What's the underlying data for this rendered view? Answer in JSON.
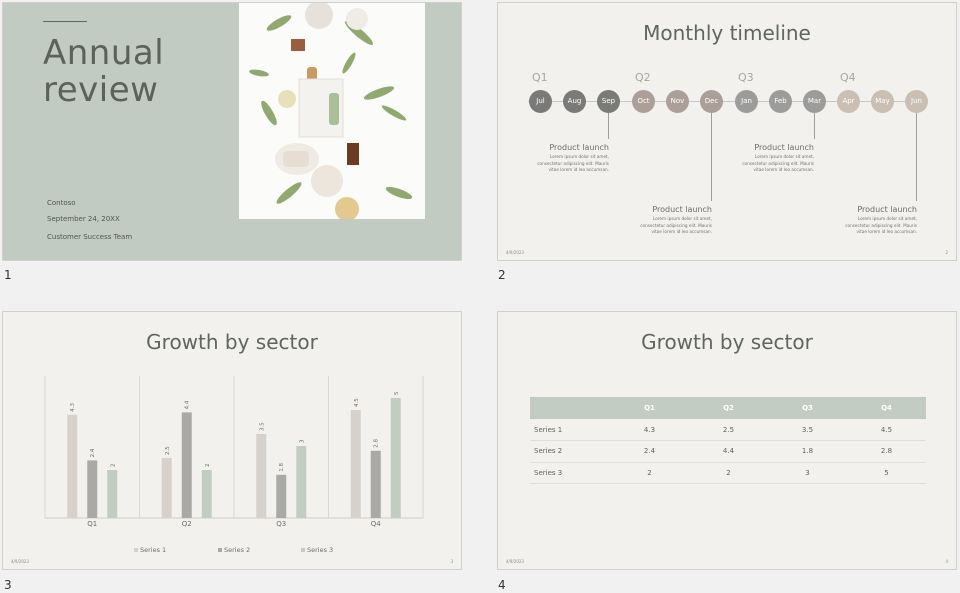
{
  "slides": [
    {
      "number": "1",
      "title_line1": "Annual",
      "title_line2": "review",
      "company": "Contoso",
      "date": "September 24, 20XX",
      "team": "Customer Success Team"
    },
    {
      "number": "2",
      "title": "Monthly timeline",
      "quarters": [
        "Q1",
        "Q2",
        "Q3",
        "Q4"
      ],
      "months": [
        "Jul",
        "Aug",
        "Sep",
        "Oct",
        "Nov",
        "Dec",
        "Jan",
        "Feb",
        "Mar",
        "Apr",
        "May",
        "Jun"
      ],
      "events": [
        {
          "heading": "Product launch",
          "body_line1": "Lorem ipsum dolor sit amet,",
          "body_line2": "consectetur adipiscing elit. Mauris",
          "body_line3": "vitae lorem id leo accumsan."
        },
        {
          "heading": "Product launch",
          "body_line1": "Lorem ipsum dolor sit amet,",
          "body_line2": "consectetur adipiscing elit. Mauris",
          "body_line3": "vitae lorem id leo accumsan."
        },
        {
          "heading": "Product launch",
          "body_line1": "Lorem ipsum dolor sit amet,",
          "body_line2": "consectetur adipiscing elit. Mauris",
          "body_line3": "vitae lorem id leo accumsan."
        },
        {
          "heading": "Product launch",
          "body_line1": "Lorem ipsum dolor sit amet,",
          "body_line2": "consectetur adipiscing elit. Mauris",
          "body_line3": "vitae lorem id leo accumsan."
        }
      ],
      "footer_date": "4/9/2023",
      "footer_num": "2"
    },
    {
      "number": "3",
      "title": "Growth by sector",
      "footer_date": "4/9/2023",
      "footer_num": "3"
    },
    {
      "number": "4",
      "title": "Growth by sector",
      "footer_date": "4/9/2023",
      "footer_num": "4",
      "table": {
        "headers": [
          "",
          "Q1",
          "Q2",
          "Q3",
          "Q4"
        ],
        "rows": [
          [
            "Series 1",
            "4.3",
            "2.5",
            "3.5",
            "4.5"
          ],
          [
            "Series 2",
            "2.4",
            "4.4",
            "1.8",
            "2.8"
          ],
          [
            "Series 3",
            "2",
            "2",
            "3",
            "5"
          ]
        ]
      }
    }
  ],
  "colors": {
    "slide1_bg": "#c2cbc2",
    "month_dark": "#7a7a78",
    "month_warm": "#ac9f97",
    "month_grey": "#9c9c9a",
    "month_light": "#c9bfb2",
    "series1": "#d6d1cb",
    "series2": "#a9a9a7",
    "series3": "#c2cdc2"
  },
  "chart_data": {
    "type": "bar",
    "categories": [
      "Q1",
      "Q2",
      "Q3",
      "Q4"
    ],
    "series": [
      {
        "name": "Series 1",
        "values": [
          4.3,
          2.5,
          3.5,
          4.5
        ]
      },
      {
        "name": "Series 2",
        "values": [
          2.4,
          4.4,
          1.8,
          2.8
        ]
      },
      {
        "name": "Series 3",
        "values": [
          2,
          2,
          3,
          5
        ]
      }
    ],
    "ylim": [
      0,
      5
    ],
    "grid": "vertical separators between categories",
    "legend": "bottom"
  }
}
